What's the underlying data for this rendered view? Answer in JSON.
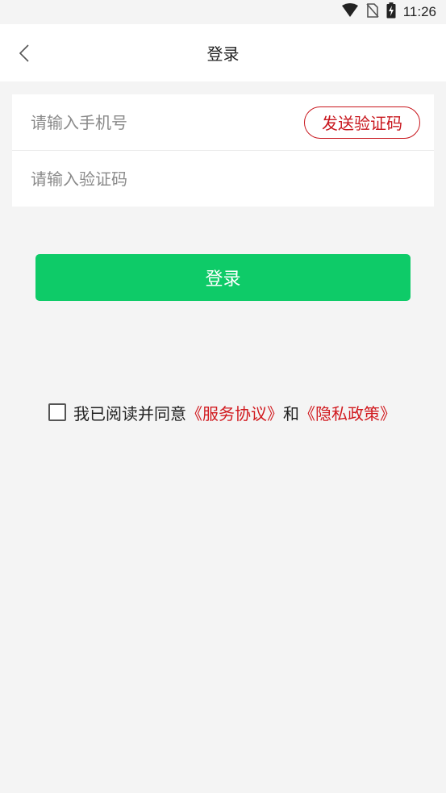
{
  "status_bar": {
    "time": "11:26",
    "icons": [
      "wifi-icon",
      "no-sim-icon",
      "battery-charging-icon"
    ]
  },
  "nav": {
    "back_icon": "chevron-left-icon",
    "title": "登录"
  },
  "form": {
    "phone_placeholder": "请输入手机号",
    "phone_value": "",
    "send_code_label": "发送验证码",
    "code_placeholder": "请输入验证码",
    "code_value": ""
  },
  "login_button": {
    "label": "登录"
  },
  "agreement": {
    "prefix": "我已阅读并同意",
    "terms_link": "《服务协议》",
    "conjunction": "和",
    "privacy_link": "《隐私政策》",
    "checked": false
  },
  "colors": {
    "primary_green": "#0ecb68",
    "link_red": "#d11a1f",
    "background": "#f4f4f4"
  }
}
